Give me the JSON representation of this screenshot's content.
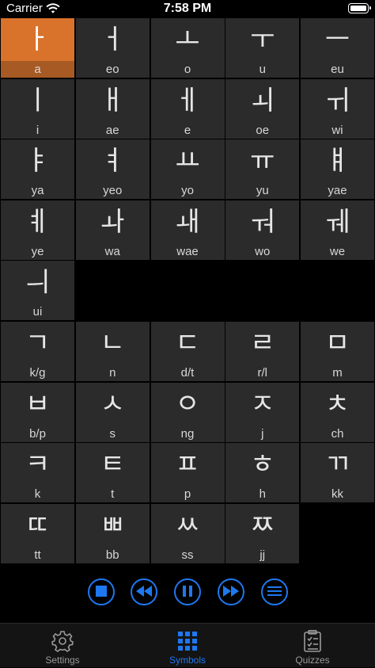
{
  "status_bar": {
    "carrier": "Carrier",
    "time": "7:58 PM"
  },
  "vowels": [
    {
      "glyph": "ㅏ",
      "rom": "a",
      "selected": true
    },
    {
      "glyph": "ㅓ",
      "rom": "eo"
    },
    {
      "glyph": "ㅗ",
      "rom": "o"
    },
    {
      "glyph": "ㅜ",
      "rom": "u"
    },
    {
      "glyph": "ㅡ",
      "rom": "eu"
    },
    {
      "glyph": "ㅣ",
      "rom": "i"
    },
    {
      "glyph": "ㅐ",
      "rom": "ae"
    },
    {
      "glyph": "ㅔ",
      "rom": "e"
    },
    {
      "glyph": "ㅚ",
      "rom": "oe"
    },
    {
      "glyph": "ㅟ",
      "rom": "wi"
    },
    {
      "glyph": "ㅑ",
      "rom": "ya"
    },
    {
      "glyph": "ㅕ",
      "rom": "yeo"
    },
    {
      "glyph": "ㅛ",
      "rom": "yo"
    },
    {
      "glyph": "ㅠ",
      "rom": "yu"
    },
    {
      "glyph": "ㅒ",
      "rom": "yae"
    },
    {
      "glyph": "ㅖ",
      "rom": "ye"
    },
    {
      "glyph": "ㅘ",
      "rom": "wa"
    },
    {
      "glyph": "ㅙ",
      "rom": "wae"
    },
    {
      "glyph": "ㅝ",
      "rom": "wo"
    },
    {
      "glyph": "ㅞ",
      "rom": "we"
    },
    {
      "glyph": "ㅢ",
      "rom": "ui"
    }
  ],
  "consonants": [
    {
      "glyph": "ㄱ",
      "rom": "k/g"
    },
    {
      "glyph": "ㄴ",
      "rom": "n"
    },
    {
      "glyph": "ㄷ",
      "rom": "d/t"
    },
    {
      "glyph": "ㄹ",
      "rom": "r/l"
    },
    {
      "glyph": "ㅁ",
      "rom": "m"
    },
    {
      "glyph": "ㅂ",
      "rom": "b/p"
    },
    {
      "glyph": "ㅅ",
      "rom": "s"
    },
    {
      "glyph": "ㅇ",
      "rom": "ng"
    },
    {
      "glyph": "ㅈ",
      "rom": "j"
    },
    {
      "glyph": "ㅊ",
      "rom": "ch"
    },
    {
      "glyph": "ㅋ",
      "rom": "k"
    },
    {
      "glyph": "ㅌ",
      "rom": "t"
    },
    {
      "glyph": "ㅍ",
      "rom": "p"
    },
    {
      "glyph": "ㅎ",
      "rom": "h"
    },
    {
      "glyph": "ㄲ",
      "rom": "kk"
    },
    {
      "glyph": "ㄸ",
      "rom": "tt"
    },
    {
      "glyph": "ㅃ",
      "rom": "bb"
    },
    {
      "glyph": "ㅆ",
      "rom": "ss"
    },
    {
      "glyph": "ㅉ",
      "rom": "jj"
    }
  ],
  "controls": [
    {
      "name": "stop-button",
      "icon": "stop-icon"
    },
    {
      "name": "previous-button",
      "icon": "rewind-icon"
    },
    {
      "name": "pause-button",
      "icon": "pause-icon"
    },
    {
      "name": "next-button",
      "icon": "play-icon"
    },
    {
      "name": "list-button",
      "icon": "list-icon"
    }
  ],
  "tabs": [
    {
      "label": "Settings",
      "icon": "gear-icon",
      "active": false
    },
    {
      "label": "Symbols",
      "icon": "grid-icon",
      "active": true
    },
    {
      "label": "Quizzes",
      "icon": "clipboard-icon",
      "active": false
    }
  ],
  "colors": {
    "accent": "#1e78f0",
    "selected_cell": "#d9722b",
    "cell": "#2b2b2b",
    "background": "#000000"
  }
}
